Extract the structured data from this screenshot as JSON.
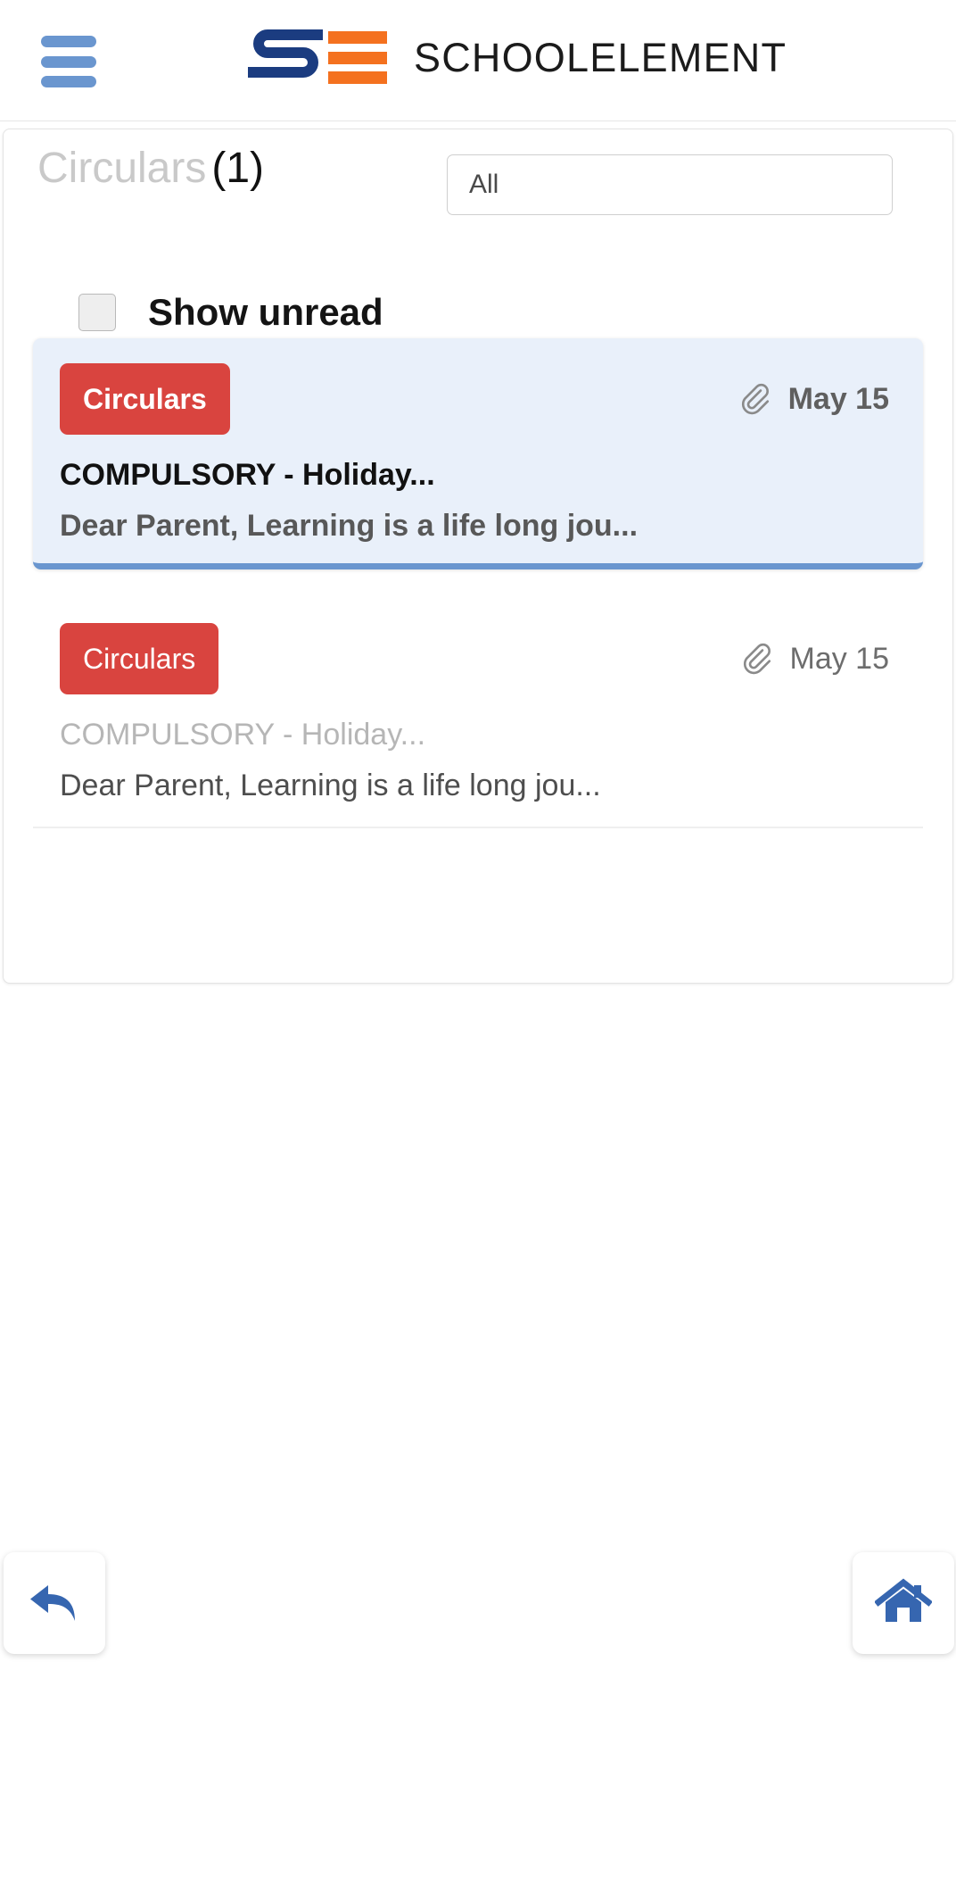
{
  "appbar": {
    "menu_icon": "hamburger-menu-icon",
    "logo_mark_icon": "schoolelement-logo-icon",
    "brand_name": "SCHOOLELEMENT",
    "brand_blue": "#1b3c80",
    "brand_orange": "#f4711f",
    "menu_color": "#6a96cf"
  },
  "panel": {
    "title": "Circulars",
    "count": "(1)",
    "filter": {
      "selected": "All",
      "options": [
        "All"
      ]
    },
    "unread": {
      "label": "Show unread",
      "checked": false
    }
  },
  "messages": [
    {
      "badge": "Circulars",
      "attachment_icon": "paperclip-icon",
      "date": "May 15",
      "title": "COMPULSORY - Holiday...",
      "preview": "Dear Parent, Learning is a life long jou...",
      "selected": true,
      "read": false,
      "highlight_color": "#e9f0fa",
      "accent_color": "#6a96cf"
    },
    {
      "badge": "Circulars",
      "attachment_icon": "paperclip-icon",
      "date": "May 15",
      "title": "COMPULSORY - Holiday...",
      "preview": "Dear Parent, Learning is a life long jou...",
      "selected": false,
      "read": true,
      "highlight_color": "#ffffff",
      "accent_color": "#efefef"
    }
  ],
  "badge_color": "#d9443f",
  "nav": {
    "back_icon": "back-arrow-icon",
    "home_icon": "home-icon",
    "icon_color": "#3666b0"
  }
}
